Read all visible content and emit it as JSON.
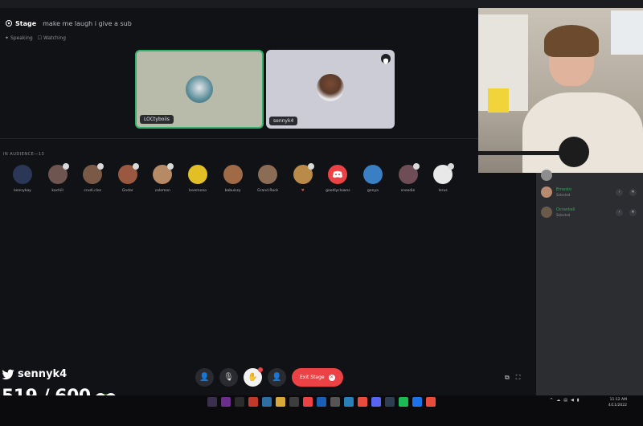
{
  "app": {
    "stage_logo": "Stage",
    "stage_topic": "make me laugh i give a sub",
    "sub_left": "Speaking",
    "sub_right": "Watching"
  },
  "speakers": [
    {
      "label": "LOCtyboiis",
      "avatar_color": "#5b8e9a"
    },
    {
      "label": "sennyk4",
      "avatar_color": "#5a3b2b",
      "is_mod": true
    }
  ],
  "audience": {
    "label": "IN AUDIENCE—13",
    "items": [
      {
        "name": "kennykay",
        "color": "#2a3756"
      },
      {
        "name": "kachiil",
        "color": "#6f5550"
      },
      {
        "name": "crudi.clos",
        "color": "#7a5a46"
      },
      {
        "name": "Gndar",
        "color": "#9a5840"
      },
      {
        "name": "colemon",
        "color": "#b68a65"
      },
      {
        "name": "lovemono",
        "color": "#e3bf26"
      },
      {
        "name": "babuiszy",
        "color": "#a06a47"
      },
      {
        "name": "Grand.Rock",
        "color": "#8b6c55"
      },
      {
        "name": "♥",
        "color": "#b98a48"
      },
      {
        "name": "goodlyclowns",
        "color": "#ed4245"
      },
      {
        "name": "genya",
        "color": "#e09a3a"
      },
      {
        "name": "snoodie",
        "color": "#6f4d57"
      },
      {
        "name": "Ierus",
        "color": "#e8e8e8"
      }
    ]
  },
  "controls": {
    "exit_label": "Exit Stage"
  },
  "members": [
    {
      "name": "",
      "sub": "",
      "color": "#8e8e8e"
    },
    {
      "name": "Ernesto",
      "sub": "Selected",
      "color": "#b88a70"
    },
    {
      "name": "Ocrankell",
      "sub": "Selected",
      "color": "#6a5a49"
    }
  ],
  "overlay": {
    "handle": "sennyk4",
    "sub_count": "519 / 600"
  },
  "taskbar": {
    "clock_time": "11:12 AM",
    "clock_date": "4/11/2022",
    "icons": [
      "#3a2f4d",
      "#6b2e8c",
      "#2b2b2b",
      "#c0392b",
      "#2d6fa3",
      "#d6a93a",
      "#3d3d3d",
      "#ed4245",
      "#1a5fb4",
      "#555555",
      "#2980b9",
      "#e84c3d",
      "#5865f2",
      "#2c3e50",
      "#1db954",
      "#1a73e8",
      "#e74c3c"
    ]
  }
}
